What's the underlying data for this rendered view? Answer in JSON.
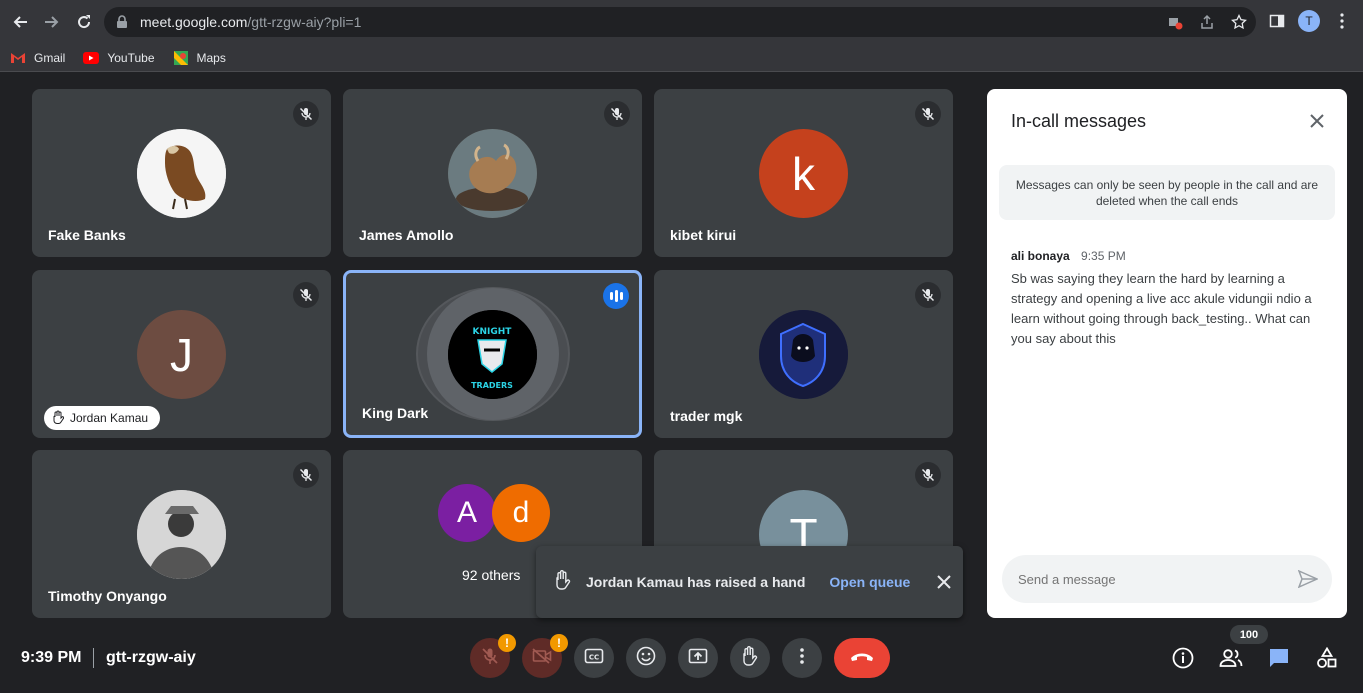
{
  "browser": {
    "url_host": "meet.google.com",
    "url_path": "/gtt-rzgw-aiy?pli=1",
    "profile_initial": "T",
    "bookmarks": [
      {
        "label": "Gmail"
      },
      {
        "label": "YouTube"
      },
      {
        "label": "Maps"
      }
    ]
  },
  "tiles": [
    {
      "name": "Fake Banks"
    },
    {
      "name": "James Amollo"
    },
    {
      "name": "kibet kirui",
      "initial": "k",
      "color": "#c5411d"
    },
    {
      "name": "Jordan Kamau",
      "initial": "J",
      "color": "#6d4c41"
    },
    {
      "name": "King Dark"
    },
    {
      "name": "trader mgk"
    },
    {
      "name": "Timothy Onyango"
    },
    {
      "name": "92 others",
      "initials": [
        "A",
        "d"
      ],
      "colors": [
        "#7b1fa2",
        "#ef6c00"
      ]
    },
    {
      "name": "",
      "initial": "T",
      "color": "#78909c"
    }
  ],
  "toast": {
    "text": "Jordan Kamau has raised a hand",
    "link": "Open queue"
  },
  "chat": {
    "title": "In-call messages",
    "notice": "Messages can only be seen by people in the call and are deleted when the call ends",
    "messages": [
      {
        "sender": "ali bonaya",
        "time": "9:35 PM",
        "text": "Sb was saying they learn the hard by learning a strategy and opening a live acc akule vidungii ndio a learn without going through back_testing.. What can you say about this"
      }
    ],
    "compose_placeholder": "Send a message"
  },
  "bottom": {
    "time": "9:39 PM",
    "meeting_code": "gtt-rzgw-aiy",
    "participant_count": "100",
    "warn_mark": "!"
  },
  "colors": {
    "background": "#202124",
    "tile": "#3c4043",
    "accent": "#8ab4f8",
    "leave": "#ea4335"
  }
}
